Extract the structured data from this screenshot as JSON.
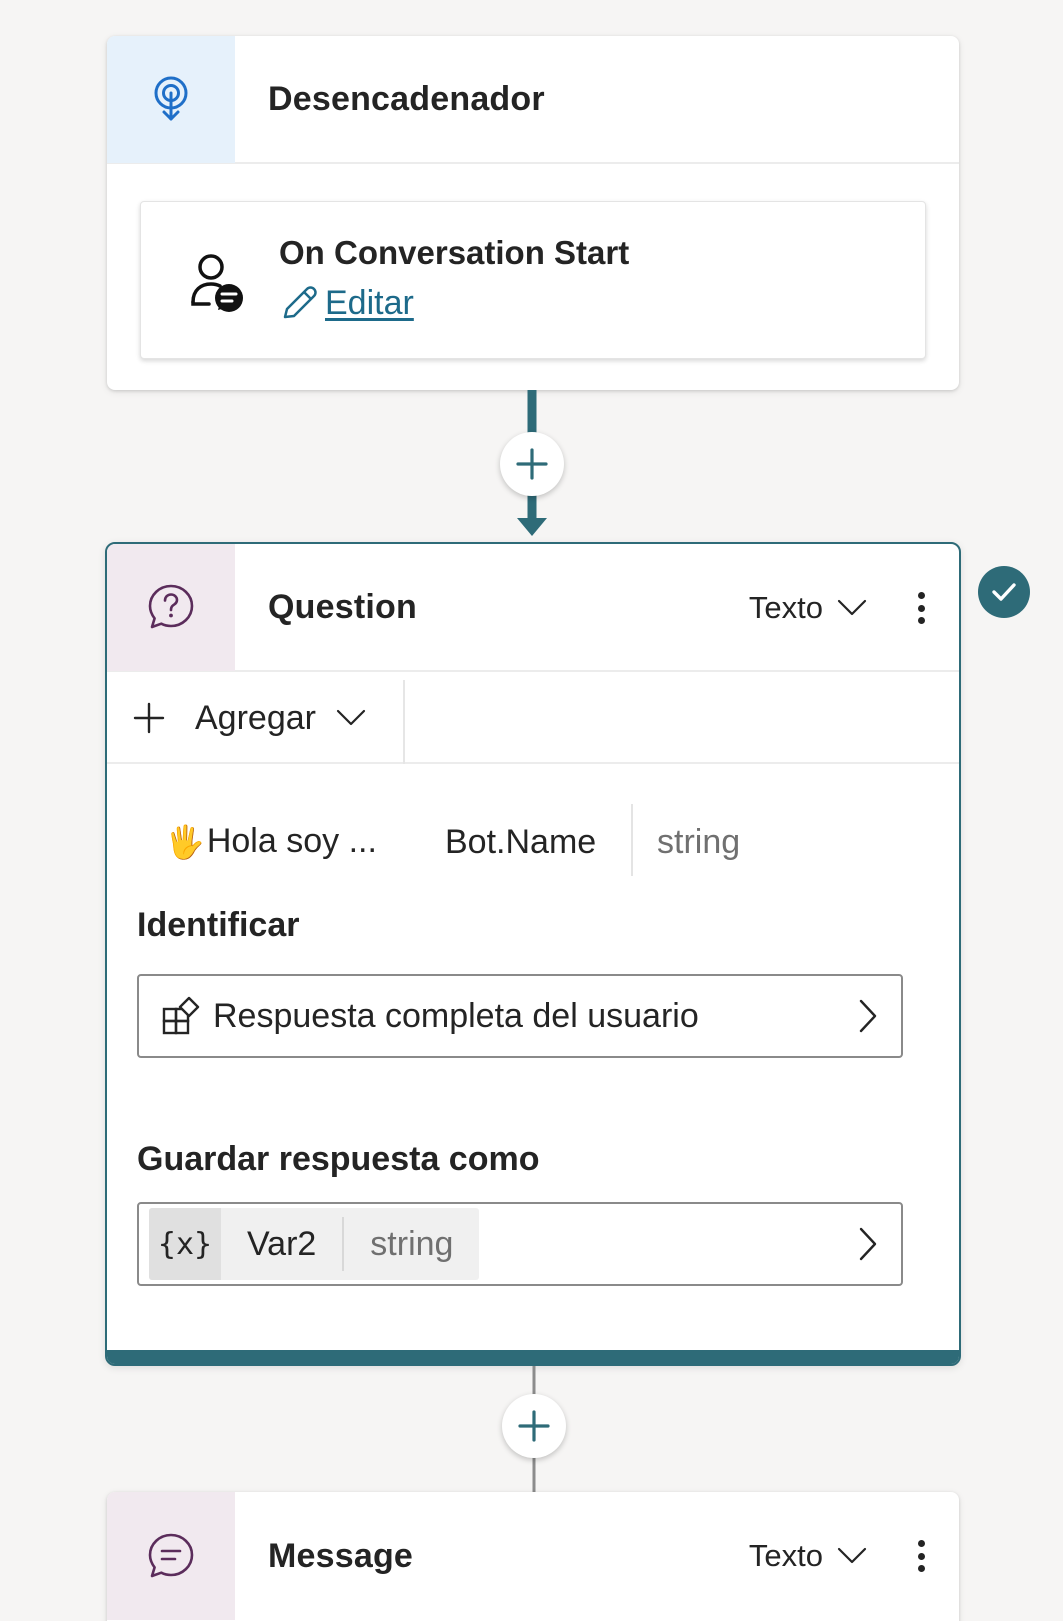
{
  "trigger": {
    "title": "Desencadenador",
    "name": "On Conversation Start",
    "edit_label": "Editar"
  },
  "question": {
    "title": "Question",
    "type_label": "Texto",
    "add_label": "Agregar",
    "prompt": {
      "emoji": "🖐",
      "text": "Hola soy ...",
      "variable": "Bot.Name",
      "variable_type": "string"
    },
    "identify": {
      "label": "Identificar",
      "value": "Respuesta completa del usuario"
    },
    "save_as": {
      "label": "Guardar respuesta como",
      "fx": "{x}",
      "variable": "Var2",
      "variable_type": "string"
    }
  },
  "message": {
    "title": "Message",
    "type_label": "Texto"
  },
  "colors": {
    "accent": "#2e6b78",
    "link": "#1d6a8a",
    "trigger_tile": "#e6f1fb",
    "node_tile": "#f1e9ef"
  },
  "icons": {
    "trigger": "trigger-icon",
    "conversation_start": "person-chat-icon",
    "edit": "pencil-icon",
    "question": "question-bubble-icon",
    "message": "message-bubble-icon",
    "add": "plus-icon",
    "entity": "entity-icon",
    "chevron": "chevron-right-icon",
    "status": "checkmark-icon"
  }
}
